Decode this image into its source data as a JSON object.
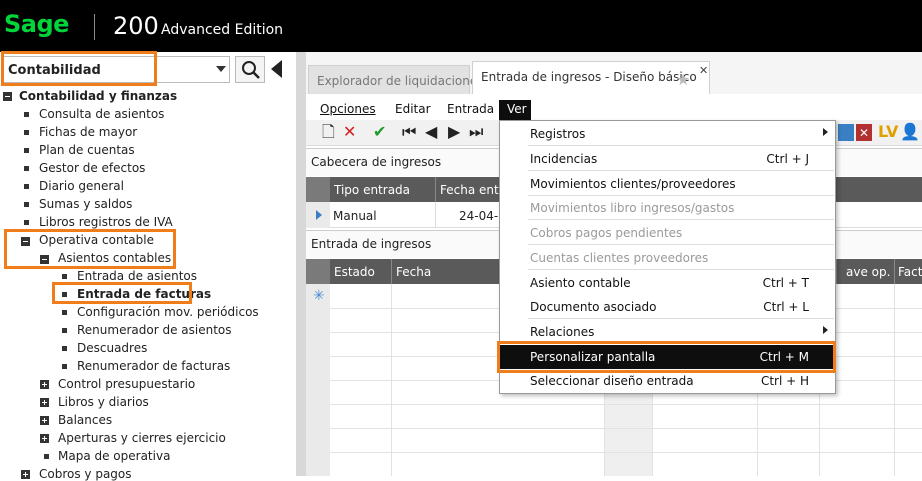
{
  "app": {
    "brand": "Sage",
    "version": "200",
    "edition": "Advanced Edition",
    "brand_color": "#00d639"
  },
  "module_selector": {
    "value": "Contabilidad"
  },
  "tree": {
    "root": "Contabilidad y finanzas",
    "items": [
      "Consulta de asientos",
      "Fichas de mayor",
      "Plan de cuentas",
      "Gestor de efectos",
      "Diario general",
      "Sumas y saldos",
      "Libros registros de IVA"
    ],
    "operativa": "Operativa contable",
    "asientos": "Asientos contables",
    "sub_items": [
      "Entrada de asientos",
      "Entrada de facturas",
      "Configuración mov. periódicos",
      "Renumerador de asientos",
      "Descuadres",
      "Renumerador de facturas"
    ],
    "after": [
      "Control presupuestario",
      "Libros y diarios",
      "Balances",
      "Aperturas y cierres ejercicio"
    ],
    "mapa": "Mapa de operativa",
    "last": "Cobros y pagos"
  },
  "tabs": [
    {
      "label": "Explorador de liquidaciones"
    },
    {
      "label": "Entrada de ingresos - Diseño básico"
    }
  ],
  "menubar": [
    "Opciones",
    "Editar",
    "Entrada",
    "Ver"
  ],
  "header_section": {
    "title": "Cabecera de ingresos",
    "columns": [
      "Tipo entrada",
      "Fecha entra"
    ],
    "row": [
      "Manual",
      "24-04-2"
    ]
  },
  "entries_section": {
    "title": "Entrada de ingresos",
    "columns": [
      "Estado",
      "Fecha",
      "ave op.",
      "Factu"
    ]
  },
  "ver_menu": {
    "items": [
      {
        "label": "Registros",
        "shortcut": "",
        "submenu": true,
        "disabled": false
      },
      {
        "label": "Incidencias",
        "shortcut": "Ctrl + J",
        "disabled": false
      },
      {
        "label": "Movimientos clientes/proveedores",
        "shortcut": "",
        "disabled": false
      },
      {
        "label": "Movimientos libro ingresos/gastos",
        "shortcut": "",
        "disabled": true
      },
      {
        "label": "Cobros pagos pendientes",
        "shortcut": "",
        "disabled": true
      },
      {
        "label": "Cuentas clientes proveedores",
        "shortcut": "",
        "disabled": true
      },
      {
        "label": "Asiento contable",
        "shortcut": "Ctrl + T",
        "disabled": false
      },
      {
        "label": "Documento asociado",
        "shortcut": "Ctrl + L",
        "disabled": false
      },
      {
        "label": "Relaciones",
        "shortcut": "",
        "submenu": true,
        "disabled": false
      },
      {
        "label": "Personalizar pantalla",
        "shortcut": "Ctrl + M",
        "disabled": false
      },
      {
        "label": "Seleccionar diseño entrada",
        "shortcut": "Ctrl + H",
        "disabled": false
      }
    ]
  },
  "highlight_color": "#f07d1a"
}
